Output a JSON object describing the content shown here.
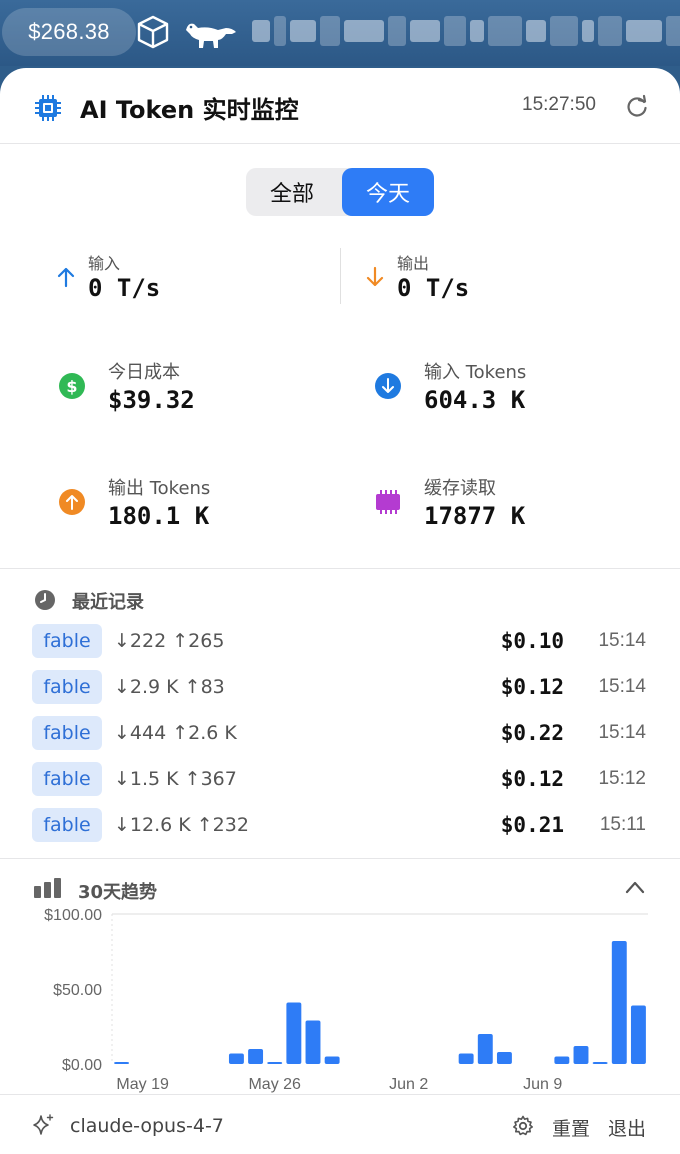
{
  "menubar": {
    "price": "$268.38",
    "icons": [
      "cube-icon",
      "pet-dinosaur-icon"
    ]
  },
  "header": {
    "title": "AI Token 实时监控",
    "time": "15:27:50",
    "icons": [
      "chip-icon",
      "refresh-icon"
    ]
  },
  "segments": {
    "all": "全部",
    "today": "今天",
    "selected": "today"
  },
  "rates": {
    "input_label": "输入",
    "input_value": "0 T/s",
    "output_label": "输出",
    "output_value": "0 T/s"
  },
  "stats": {
    "cost_label": "今日成本",
    "cost_value": "$39.32",
    "input_tokens_label": "输入 Tokens",
    "input_tokens_value": "604.3 K",
    "output_tokens_label": "输出 Tokens",
    "output_tokens_value": "180.1 K",
    "cache_label": "缓存读取",
    "cache_value": "17877 K"
  },
  "recent": {
    "title": "最近记录",
    "records": [
      {
        "tag": "fable",
        "tokens": "↓222 ↑265",
        "cost": "$0.10",
        "time": "15:14"
      },
      {
        "tag": "fable",
        "tokens": "↓2.9 K ↑83",
        "cost": "$0.12",
        "time": "15:14"
      },
      {
        "tag": "fable",
        "tokens": "↓444 ↑2.6 K",
        "cost": "$0.22",
        "time": "15:14"
      },
      {
        "tag": "fable",
        "tokens": "↓1.5 K ↑367",
        "cost": "$0.12",
        "time": "15:12"
      },
      {
        "tag": "fable",
        "tokens": "↓12.6 K ↑232",
        "cost": "$0.21",
        "time": "15:11"
      }
    ]
  },
  "trend": {
    "title": "30天趋势"
  },
  "chart_data": {
    "type": "bar",
    "y_ticks": [
      "$100.00",
      "$50.00",
      "$0.00"
    ],
    "x_ticks": [
      "May 19",
      "May 26",
      "Jun 2",
      "Jun 9"
    ],
    "ylim": [
      0,
      100
    ],
    "bar_color": "#2e7cf6",
    "values": [
      1,
      0,
      0,
      0,
      0,
      0,
      7,
      10,
      1,
      41,
      29,
      5,
      0,
      0,
      0,
      0,
      0,
      0,
      7,
      20,
      8,
      0,
      0,
      5,
      12,
      1,
      82,
      39
    ]
  },
  "footer": {
    "model": "claude-opus-4-7",
    "reset": "重置",
    "quit": "退出"
  },
  "colors": {
    "accent": "#2e7cf6",
    "green": "#30b955",
    "orange": "#f08a24",
    "purple": "#b43bd1",
    "blue": "#1f7ae0"
  }
}
